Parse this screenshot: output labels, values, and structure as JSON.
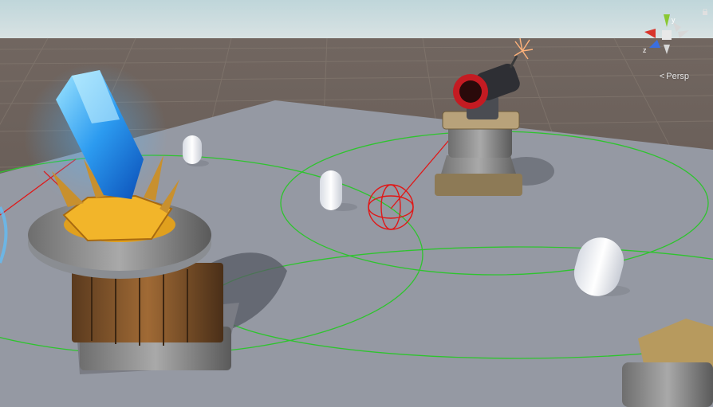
{
  "viewport": {
    "projection_label": "Persp",
    "projection_icon": "chevron-left-icon"
  },
  "gizmo": {
    "axis_y_label": "y",
    "axis_z_label": "z",
    "axis_x_color": "#d9342b",
    "axis_y_color": "#8ac832",
    "axis_z_color": "#3a6fe0"
  },
  "scene": {
    "sky_color": "#cfe0e3",
    "ground_color": "#6b605a",
    "plane_color": "#9599a3",
    "gizmo_line_color": "#2ec42e",
    "aim_line_color": "#e01818",
    "objects": [
      "crystal-tower",
      "cannon-tower",
      "capsule",
      "capsule",
      "capsule",
      "target-reticle"
    ]
  }
}
